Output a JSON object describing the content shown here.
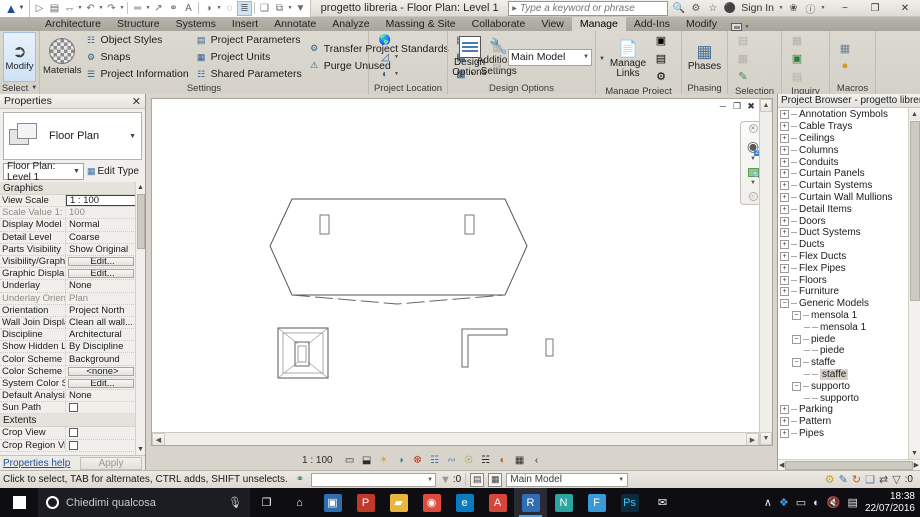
{
  "titlebar": {
    "app_logo": "revit-logo",
    "document_title": "progetto libreria - Floor Plan: Level 1",
    "search_placeholder": "Type a keyword or phrase",
    "sign_in": "Sign In",
    "qat_items": [
      {
        "name": "open",
        "glyph": "▷"
      },
      {
        "name": "save",
        "glyph": "▤"
      },
      {
        "name": "save-as",
        "glyph": "❐"
      },
      {
        "name": "undo",
        "glyph": "↶"
      },
      {
        "name": "redo",
        "glyph": "↷"
      },
      {
        "name": "measure",
        "glyph": "☰"
      },
      {
        "name": "aligned-dimension",
        "glyph": "↗"
      },
      {
        "name": "tag",
        "glyph": "◌"
      },
      {
        "name": "text",
        "glyph": "A"
      },
      {
        "name": "default-3d-view",
        "glyph": "◔"
      },
      {
        "name": "section",
        "glyph": "○"
      },
      {
        "name": "thin-lines",
        "glyph": "≣"
      },
      {
        "name": "close-hidden-windows",
        "glyph": "❑"
      },
      {
        "name": "switch-windows",
        "glyph": "⧉"
      },
      {
        "name": "customize-qat",
        "glyph": "▾"
      }
    ],
    "window_buttons": [
      "─",
      "❐",
      "✕"
    ]
  },
  "tabs": [
    {
      "label": "Architecture",
      "active": false
    },
    {
      "label": "Structure",
      "active": false
    },
    {
      "label": "Systems",
      "active": false
    },
    {
      "label": "Insert",
      "active": false
    },
    {
      "label": "Annotate",
      "active": false
    },
    {
      "label": "Analyze",
      "active": false
    },
    {
      "label": "Massing & Site",
      "active": false
    },
    {
      "label": "Collaborate",
      "active": false
    },
    {
      "label": "View",
      "active": false
    },
    {
      "label": "Manage",
      "active": true
    },
    {
      "label": "Add-Ins",
      "active": false
    },
    {
      "label": "Modify",
      "active": false
    }
  ],
  "ribbon": {
    "select": {
      "title": "Select",
      "modify_label": "Modify",
      "cursor_icon": "arrow-cursor-icon"
    },
    "settings": {
      "title": "Settings",
      "materials_label": "Materials",
      "col1": [
        {
          "label": "Object Styles",
          "icon": "object-styles-icon"
        },
        {
          "label": "Snaps",
          "icon": "snaps-icon"
        },
        {
          "label": "Project Information",
          "icon": "project-information-icon"
        }
      ],
      "col2": [
        {
          "label": "Project Parameters",
          "icon": "project-parameters-icon"
        },
        {
          "label": "Project Units",
          "icon": "project-units-icon"
        },
        {
          "label": "Shared Parameters",
          "icon": "shared-parameters-icon"
        }
      ],
      "col3": [
        {
          "label": "Transfer Project Standards",
          "icon": "transfer-project-standards-icon"
        },
        {
          "label": "Purge Unused",
          "icon": "purge-unused-icon"
        }
      ],
      "additional_settings_label": "Additional Settings"
    },
    "project_location": {
      "title": "Project Location"
    },
    "design_options": {
      "title": "Design Options",
      "button_label": "Design Options",
      "combo_value": "Main Model"
    },
    "manage_project": {
      "title": "Manage Project",
      "manage_links_label": "Manage Links"
    },
    "phasing": {
      "title": "Phasing",
      "phases_label": "Phases"
    },
    "selection": {
      "title": "Selection"
    },
    "inquiry": {
      "title": "Inquiry"
    },
    "macros": {
      "title": "Macros"
    }
  },
  "properties": {
    "title": "Properties",
    "close_icon": "✕",
    "type_name": "Floor Plan",
    "type_selector": "Floor Plan: Level 1",
    "edit_type_label": "Edit Type",
    "groups": [
      {
        "name": "Graphics",
        "rows": [
          {
            "key": "View Scale",
            "value": "1 : 100",
            "kind": "boxed"
          },
          {
            "key": "Scale Value    1:",
            "value": "100",
            "kind": "dim"
          },
          {
            "key": "Display Model",
            "value": "Normal",
            "kind": "text"
          },
          {
            "key": "Detail Level",
            "value": "Coarse",
            "kind": "text"
          },
          {
            "key": "Parts Visibility",
            "value": "Show Original",
            "kind": "text"
          },
          {
            "key": "Visibility/Graph...",
            "value": "Edit...",
            "kind": "button"
          },
          {
            "key": "Graphic Displa...",
            "value": "Edit...",
            "kind": "button"
          },
          {
            "key": "Underlay",
            "value": "None",
            "kind": "text"
          },
          {
            "key": "Underlay Orien...",
            "value": "Plan",
            "kind": "dim"
          },
          {
            "key": "Orientation",
            "value": "Project North",
            "kind": "text"
          },
          {
            "key": "Wall Join Display",
            "value": "Clean all wall...",
            "kind": "text"
          },
          {
            "key": "Discipline",
            "value": "Architectural",
            "kind": "text"
          },
          {
            "key": "Show Hidden L...",
            "value": "By Discipline",
            "kind": "text"
          },
          {
            "key": "Color Scheme ...",
            "value": "Background",
            "kind": "text"
          },
          {
            "key": "Color Scheme",
            "value": "<none>",
            "kind": "button"
          },
          {
            "key": "System Color S...",
            "value": "Edit...",
            "kind": "button"
          },
          {
            "key": "Default Analysi...",
            "value": "None",
            "kind": "text"
          },
          {
            "key": "Sun Path",
            "value": "",
            "kind": "checkbox"
          }
        ]
      },
      {
        "name": "Extents",
        "rows": [
          {
            "key": "Crop View",
            "value": "",
            "kind": "checkbox"
          },
          {
            "key": "Crop Region Vi...",
            "value": "",
            "kind": "checkbox"
          }
        ]
      }
    ],
    "help_link": "Properties help",
    "apply_label": "Apply"
  },
  "canvas": {
    "window_buttons": [
      "─",
      "❐",
      "✖"
    ],
    "collapse_icon": "˄",
    "navbar": {
      "steering_wheel_icon": "steering-wheel-icon",
      "badge": "2D",
      "zoom_icon": "zoom-region-icon"
    }
  },
  "viewbar": {
    "scale": "1 : 100",
    "icons": [
      {
        "name": "detail-level-coarse-icon",
        "glyph": "▭"
      },
      {
        "name": "visual-style-icon",
        "glyph": "⬓"
      },
      {
        "name": "sun-path-off-icon",
        "glyph": "☀"
      },
      {
        "name": "shadows-off-icon",
        "glyph": "◑"
      },
      {
        "name": "rendering-dialog-icon",
        "glyph": "❆"
      },
      {
        "name": "crop-view-icon",
        "glyph": "⌗"
      },
      {
        "name": "show-crop-region-icon",
        "glyph": "❒"
      },
      {
        "name": "unlocked-3d-view-icon",
        "glyph": "⚲"
      },
      {
        "name": "temporary-hide-isolate-icon",
        "glyph": "◎"
      },
      {
        "name": "reveal-hidden-elements-icon",
        "glyph": "◍"
      },
      {
        "name": "analytical-model-icon",
        "glyph": "⬚"
      },
      {
        "name": "expand-icon",
        "glyph": "‹"
      }
    ]
  },
  "browser": {
    "title": "Project Browser - progetto libreria",
    "close_icon": "✕",
    "nodes": [
      {
        "label": "Annotation Symbols",
        "depth": 1,
        "state": "collapsed"
      },
      {
        "label": "Cable Trays",
        "depth": 1,
        "state": "collapsed"
      },
      {
        "label": "Ceilings",
        "depth": 1,
        "state": "collapsed"
      },
      {
        "label": "Columns",
        "depth": 1,
        "state": "collapsed"
      },
      {
        "label": "Conduits",
        "depth": 1,
        "state": "collapsed"
      },
      {
        "label": "Curtain Panels",
        "depth": 1,
        "state": "collapsed"
      },
      {
        "label": "Curtain Systems",
        "depth": 1,
        "state": "collapsed"
      },
      {
        "label": "Curtain Wall Mullions",
        "depth": 1,
        "state": "collapsed"
      },
      {
        "label": "Detail Items",
        "depth": 1,
        "state": "collapsed"
      },
      {
        "label": "Doors",
        "depth": 1,
        "state": "collapsed"
      },
      {
        "label": "Duct Systems",
        "depth": 1,
        "state": "collapsed"
      },
      {
        "label": "Ducts",
        "depth": 1,
        "state": "collapsed"
      },
      {
        "label": "Flex Ducts",
        "depth": 1,
        "state": "collapsed"
      },
      {
        "label": "Flex Pipes",
        "depth": 1,
        "state": "collapsed"
      },
      {
        "label": "Floors",
        "depth": 1,
        "state": "collapsed"
      },
      {
        "label": "Furniture",
        "depth": 1,
        "state": "collapsed"
      },
      {
        "label": "Generic Models",
        "depth": 1,
        "state": "expanded"
      },
      {
        "label": "mensola 1",
        "depth": 2,
        "state": "expanded"
      },
      {
        "label": "mensola 1",
        "depth": 3,
        "state": "leaf"
      },
      {
        "label": "piede",
        "depth": 2,
        "state": "expanded"
      },
      {
        "label": "piede",
        "depth": 3,
        "state": "leaf"
      },
      {
        "label": "staffe",
        "depth": 2,
        "state": "expanded"
      },
      {
        "label": "staffe",
        "depth": 3,
        "state": "leaf",
        "selected": true
      },
      {
        "label": "supporto",
        "depth": 2,
        "state": "expanded"
      },
      {
        "label": "supporto",
        "depth": 3,
        "state": "leaf"
      },
      {
        "label": "Parking",
        "depth": 1,
        "state": "collapsed"
      },
      {
        "label": "Pattern",
        "depth": 1,
        "state": "collapsed"
      },
      {
        "label": "Pipes",
        "depth": 1,
        "state": "collapsed"
      }
    ]
  },
  "statusbar": {
    "message": "Click to select, TAB for alternates, CTRL adds, SHIFT unselects.",
    "worksharing_icon": "worksharing-icon",
    "filter_count": ":0",
    "design_option": "Main Model",
    "right_icons": [
      {
        "name": "worksets-icon",
        "glyph": "⚒",
        "color": "#c9a227"
      },
      {
        "name": "editing-request-icon",
        "glyph": "✎",
        "color": "#3b72b0"
      },
      {
        "name": "reload-latest-icon",
        "glyph": "↻",
        "color": "#c0622c"
      },
      {
        "name": "relinquish-icon",
        "glyph": "❑",
        "color": "#4a7fb5"
      },
      {
        "name": "synchronize-icon",
        "glyph": "⇄",
        "color": "#555555"
      },
      {
        "name": "filter-icon",
        "glyph": "▽",
        "color": "#555555"
      }
    ],
    "filter_right_count": ":0"
  },
  "taskbar": {
    "cortana_placeholder": "Chiedimi qualcosa",
    "mic_icon": "microphone-icon",
    "apps": [
      {
        "name": "task-view",
        "glyph": "❐",
        "bg": "transparent",
        "fg": "#ffffff",
        "active": false
      },
      {
        "name": "store",
        "glyph": "⌂",
        "bg": "transparent",
        "fg": "#ffffff",
        "active": false
      },
      {
        "name": "file-explorer-blue",
        "glyph": "▣",
        "bg": "#2d6fae",
        "fg": "#ffffff",
        "active": false
      },
      {
        "name": "powerpoint",
        "glyph": "P",
        "bg": "#c0392b",
        "fg": "#ffffff",
        "active": false
      },
      {
        "name": "file-explorer",
        "glyph": "▰",
        "bg": "#e8b63a",
        "fg": "#ffffff",
        "active": false
      },
      {
        "name": "chrome",
        "glyph": "◉",
        "bg": "#dd4b3e",
        "fg": "#ffffff",
        "active": false
      },
      {
        "name": "edge",
        "glyph": "e",
        "bg": "#0b7bc1",
        "fg": "#ffffff",
        "active": false
      },
      {
        "name": "autocad",
        "glyph": "A",
        "bg": "#d6453a",
        "fg": "#ffffff",
        "active": false
      },
      {
        "name": "revit",
        "glyph": "R",
        "bg": "#2f6eb5",
        "fg": "#ffffff",
        "active": true
      },
      {
        "name": "navisworks",
        "glyph": "N",
        "bg": "#2aa6a0",
        "fg": "#ffffff",
        "active": false
      },
      {
        "name": "formit",
        "glyph": "F",
        "bg": "#3a9ad9",
        "fg": "#ffffff",
        "active": false
      },
      {
        "name": "photoshop",
        "glyph": "Ps",
        "bg": "#0b2a3d",
        "fg": "#3ec6f0",
        "active": false
      },
      {
        "name": "mail",
        "glyph": "✉",
        "bg": "transparent",
        "fg": "#ffffff",
        "active": false
      }
    ],
    "tray": [
      {
        "name": "show-hidden-icons",
        "glyph": "∧"
      },
      {
        "name": "dropbox-icon",
        "glyph": "❖"
      },
      {
        "name": "battery-icon",
        "glyph": "▭"
      },
      {
        "name": "wifi-icon",
        "glyph": "◠"
      },
      {
        "name": "volume-muted-icon",
        "glyph": "⧸"
      },
      {
        "name": "action-center-icon",
        "glyph": "▤"
      }
    ],
    "time": "18:38",
    "date": "22/07/2016"
  }
}
